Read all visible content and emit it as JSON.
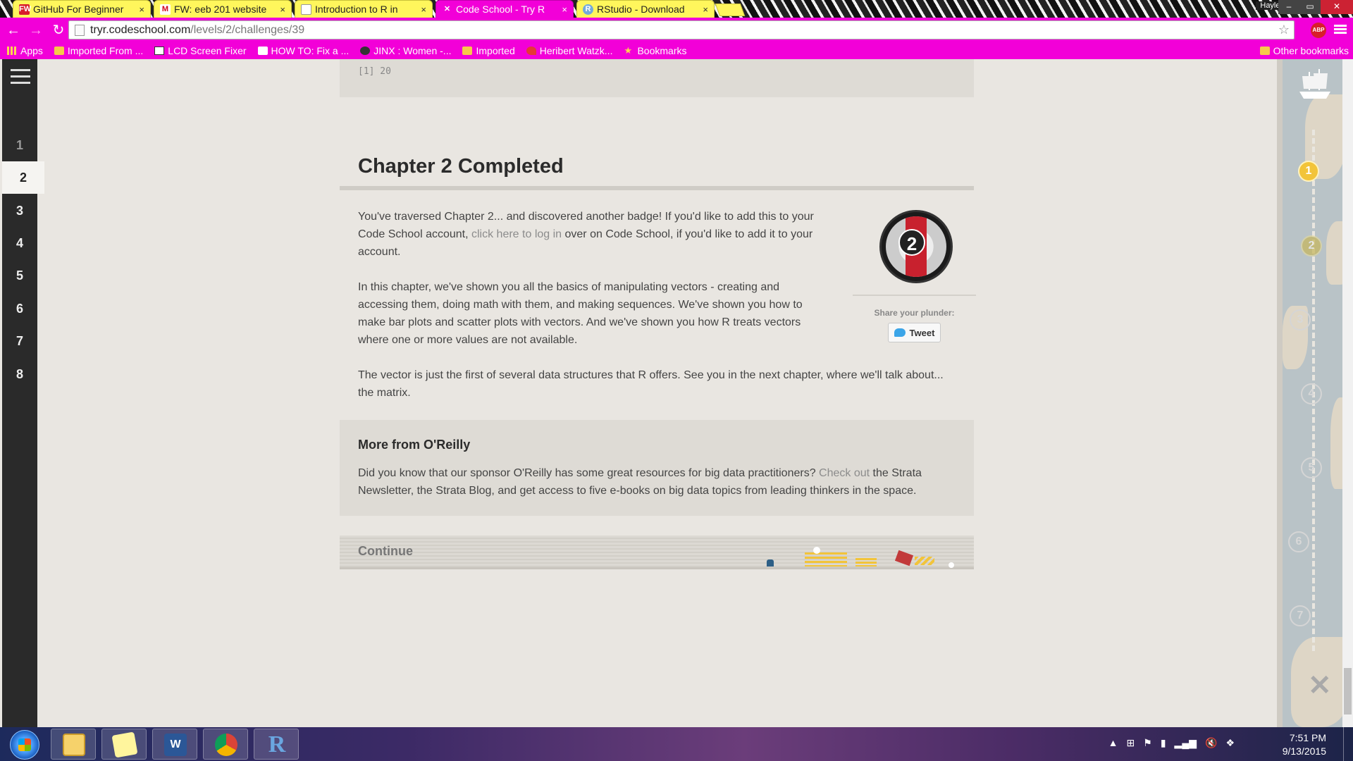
{
  "browser": {
    "tabs": [
      {
        "label": "GitHub For Beginner",
        "favicon_color": "#d81e2b",
        "favicon_text": "FW"
      },
      {
        "label": "FW: eeb 201 website",
        "favicon_color": "#d0021b",
        "favicon_text": "M"
      },
      {
        "label": "Introduction to R in",
        "favicon_color": "#777777",
        "favicon_text": ""
      },
      {
        "label": "Code School - Try R",
        "favicon_color": "#f200d8",
        "favicon_text": "✕",
        "active": true
      },
      {
        "label": "RStudio - Download",
        "favicon_color": "#75aadb",
        "favicon_text": "R"
      }
    ],
    "profile_name": "Hayley",
    "url": {
      "host": "tryr.codeschool.com",
      "path": "/levels/2/challenges/39"
    },
    "bookmarks": [
      {
        "label": "Apps",
        "icon": "apps-grid-icon"
      },
      {
        "label": "Imported From ...",
        "icon": "folder-icon"
      },
      {
        "label": "LCD Screen Fixer",
        "icon": "lcd-icon"
      },
      {
        "label": "HOW TO: Fix a ...",
        "icon": "site-c-icon"
      },
      {
        "label": "JINX : Women -...",
        "icon": "skull-icon"
      },
      {
        "label": "Imported",
        "icon": "folder-icon"
      },
      {
        "label": "Heribert Watzk...",
        "icon": "heart-icon"
      },
      {
        "label": "Bookmarks",
        "icon": "star-icon"
      }
    ],
    "other_bookmarks": "Other bookmarks",
    "accent_color": "#f200d8"
  },
  "levels": [
    "1",
    "2",
    "3",
    "4",
    "5",
    "6",
    "7",
    "8"
  ],
  "current_level": "2",
  "code_output": "[1] 20",
  "chapter": {
    "title": "Chapter 2 Completed",
    "p1_before": "You've traversed Chapter 2... and discovered another badge! If you'd like to add this to your Code School account, ",
    "p1_link": "click here to log in",
    "p1_after": " over on Code School, if you'd like to add it to your account.",
    "p2": "In this chapter, we've shown you all the basics of manipulating vectors - creating and accessing them, doing math with them, and making sequences. We've shown you how to make bar plots and scatter plots with vectors. And we've shown you how R treats vectors where one or more values are not available.",
    "p3": "The vector is just the first of several data structures that R offers. See you in the next chapter, where we'll talk about... the matrix.",
    "badge_number": "2",
    "share_label": "Share your plunder:",
    "tweet_label": "Tweet"
  },
  "more": {
    "title": "More from O'Reilly",
    "text_before": "Did you know that our sponsor O'Reilly has some great resources for big data practitioners? ",
    "link": "Check out",
    "text_after": " the Strata Newsletter, the Strata Blog, and get access to five e-books on big data topics from leading thinkers in the space."
  },
  "continue_label": "Continue",
  "map": {
    "waypoints": [
      {
        "label": "1",
        "state": "complete"
      },
      {
        "label": "2",
        "state": "partial"
      },
      {
        "label": "3",
        "state": "locked"
      },
      {
        "label": "4",
        "state": "locked"
      },
      {
        "label": "5",
        "state": "locked"
      },
      {
        "label": "6",
        "state": "locked"
      },
      {
        "label": "7",
        "state": "locked"
      }
    ]
  },
  "taskbar": {
    "apps": [
      "file-explorer-icon",
      "sticky-notes-icon",
      "word-icon",
      "chrome-icon",
      "r-icon"
    ],
    "time": "7:51 PM",
    "date": "9/13/2015"
  }
}
